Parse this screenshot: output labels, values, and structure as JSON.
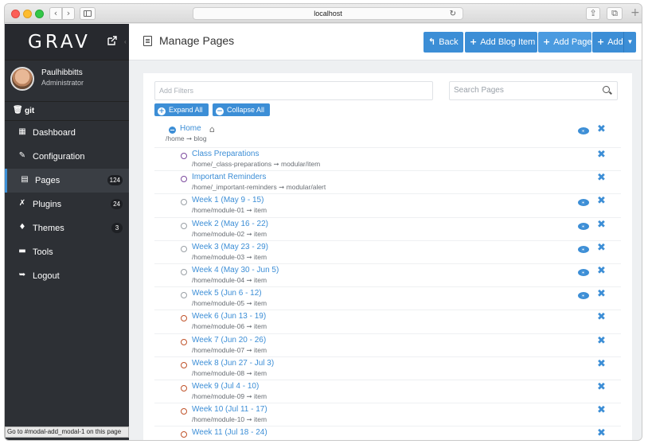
{
  "browser": {
    "url": "localhost",
    "back_glyph": "‹",
    "forward_glyph": "›",
    "reload_glyph": "↻",
    "share_glyph": "⇪",
    "tabs_glyph": "⧉",
    "new_tab_glyph": "+"
  },
  "sidebar": {
    "logo": "GRAV",
    "user_name": "Paulhibbitts",
    "user_role": "Administrator",
    "git_label": "git",
    "items": [
      {
        "label": "Dashboard",
        "icon": "th-icon",
        "glyph": "▦",
        "badge": ""
      },
      {
        "label": "Configuration",
        "icon": "wrench-icon",
        "glyph": "✎",
        "badge": ""
      },
      {
        "label": "Pages",
        "icon": "file-icon",
        "glyph": "▤",
        "badge": "124"
      },
      {
        "label": "Plugins",
        "icon": "plug-icon",
        "glyph": "✗",
        "badge": "24"
      },
      {
        "label": "Themes",
        "icon": "tint-icon",
        "glyph": "♦",
        "badge": "3"
      },
      {
        "label": "Tools",
        "icon": "briefcase-icon",
        "glyph": "▬",
        "badge": ""
      },
      {
        "label": "Logout",
        "icon": "sign-out-icon",
        "glyph": "➥",
        "badge": ""
      }
    ],
    "status_text": "Go to #modal-add_modal-1 on this page"
  },
  "header": {
    "title": "Manage Pages",
    "buttons": {
      "back": "Back",
      "add_blog_item": "Add Blog Item",
      "add_page": "Add Page",
      "add": "Add"
    }
  },
  "filters": {
    "filter_placeholder": "Add Filters",
    "search_placeholder": "Search Pages",
    "expand_all": "Expand All",
    "collapse_all": "Collapse All"
  },
  "pages": {
    "home": {
      "title": "Home",
      "route": "/home",
      "template": "blog"
    },
    "arrow": "➞",
    "children": [
      {
        "title": "Class Preparations",
        "route": "/home/_class-preparations",
        "template": "modular/item",
        "dot_color": "#7c4a9e",
        "visible": false
      },
      {
        "title": "Important Reminders",
        "route": "/home/_important-reminders",
        "template": "modular/alert",
        "dot_color": "#7c4a9e",
        "visible": false
      },
      {
        "title": "Week 1 (May 9 - 15)",
        "route": "/home/module-01",
        "template": "item",
        "dot_color": "#9aa0a6",
        "visible": true
      },
      {
        "title": "Week 2 (May 16 - 22)",
        "route": "/home/module-02",
        "template": "item",
        "dot_color": "#9aa0a6",
        "visible": true
      },
      {
        "title": "Week 3 (May 23 - 29)",
        "route": "/home/module-03",
        "template": "item",
        "dot_color": "#9aa0a6",
        "visible": true
      },
      {
        "title": "Week 4 (May 30 - Jun 5)",
        "route": "/home/module-04",
        "template": "item",
        "dot_color": "#9aa0a6",
        "visible": true
      },
      {
        "title": "Week 5 (Jun 6 - 12)",
        "route": "/home/module-05",
        "template": "item",
        "dot_color": "#9aa0a6",
        "visible": true
      },
      {
        "title": "Week 6 (Jun 13 - 19)",
        "route": "/home/module-06",
        "template": "item",
        "dot_color": "#c0532a",
        "visible": false
      },
      {
        "title": "Week 7 (Jun 20 - 26)",
        "route": "/home/module-07",
        "template": "item",
        "dot_color": "#c0532a",
        "visible": false
      },
      {
        "title": "Week 8 (Jun 27 - Jul 3)",
        "route": "/home/module-08",
        "template": "item",
        "dot_color": "#c0532a",
        "visible": false
      },
      {
        "title": "Week 9 (Jul 4 - 10)",
        "route": "/home/module-09",
        "template": "item",
        "dot_color": "#c0532a",
        "visible": false
      },
      {
        "title": "Week 10 (Jul 11 - 17)",
        "route": "/home/module-10",
        "template": "item",
        "dot_color": "#c0532a",
        "visible": false
      },
      {
        "title": "Week 11 (Jul 18 - 24)",
        "route": "",
        "template": "",
        "dot_color": "#c0532a",
        "visible": false
      }
    ]
  }
}
